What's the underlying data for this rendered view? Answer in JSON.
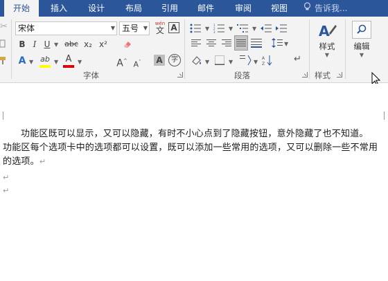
{
  "tabs": [
    {
      "label": "开始",
      "active": true
    },
    {
      "label": "插入",
      "active": false
    },
    {
      "label": "设计",
      "active": false
    },
    {
      "label": "布局",
      "active": false
    },
    {
      "label": "引用",
      "active": false
    },
    {
      "label": "邮件",
      "active": false
    },
    {
      "label": "审阅",
      "active": false
    },
    {
      "label": "视图",
      "active": false
    }
  ],
  "tell_me": {
    "label": "告诉我..."
  },
  "font_group": {
    "font_name": "宋体",
    "font_size": "五号",
    "phonetic_top": "wén",
    "phonetic_bottom": "文",
    "border_char": "A",
    "bold": "B",
    "italic": "I",
    "underline": "U",
    "strike": "abc",
    "subscript": "x₂",
    "superscript": "x²",
    "text_effect": "A",
    "highlight": "ab",
    "font_color": "A",
    "grow": "A",
    "shrink": "A",
    "shading": "A",
    "enclose": "字",
    "label": "字体"
  },
  "para_group": {
    "label": "段落",
    "show_marks": "↵"
  },
  "styles_group": {
    "button_label": "样式",
    "label": "样式"
  },
  "edit_group": {
    "button_label": "编辑"
  },
  "colors": {
    "tab_bar": "#2b579a",
    "ribbon": "#f3f3f3",
    "highlight_yellow": "#ffff00",
    "font_red": "#e00000"
  },
  "document": {
    "paragraphs": [
      "功能区既可以显示，又可以隐藏，有时不小心点到了隐藏按钮，意外隐藏了也不知道。",
      "功能区每个选项卡中的选项都可以设置，既可以添加一些常用的选项，又可以删除一些不常用",
      "的选项。"
    ],
    "paragraph_mark": "↵"
  }
}
